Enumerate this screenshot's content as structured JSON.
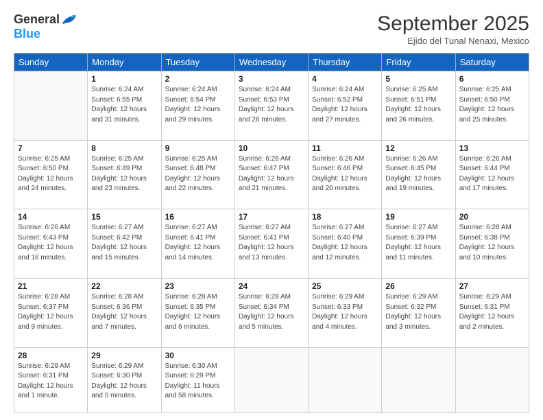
{
  "header": {
    "logo_general": "General",
    "logo_blue": "Blue",
    "month_title": "September 2025",
    "location": "Ejido del Tunal Nenaxi, Mexico"
  },
  "days_of_week": [
    "Sunday",
    "Monday",
    "Tuesday",
    "Wednesday",
    "Thursday",
    "Friday",
    "Saturday"
  ],
  "weeks": [
    [
      {
        "day": "",
        "info": ""
      },
      {
        "day": "1",
        "info": "Sunrise: 6:24 AM\nSunset: 6:55 PM\nDaylight: 12 hours\nand 31 minutes."
      },
      {
        "day": "2",
        "info": "Sunrise: 6:24 AM\nSunset: 6:54 PM\nDaylight: 12 hours\nand 29 minutes."
      },
      {
        "day": "3",
        "info": "Sunrise: 6:24 AM\nSunset: 6:53 PM\nDaylight: 12 hours\nand 28 minutes."
      },
      {
        "day": "4",
        "info": "Sunrise: 6:24 AM\nSunset: 6:52 PM\nDaylight: 12 hours\nand 27 minutes."
      },
      {
        "day": "5",
        "info": "Sunrise: 6:25 AM\nSunset: 6:51 PM\nDaylight: 12 hours\nand 26 minutes."
      },
      {
        "day": "6",
        "info": "Sunrise: 6:25 AM\nSunset: 6:50 PM\nDaylight: 12 hours\nand 25 minutes."
      }
    ],
    [
      {
        "day": "7",
        "info": "Sunrise: 6:25 AM\nSunset: 6:50 PM\nDaylight: 12 hours\nand 24 minutes."
      },
      {
        "day": "8",
        "info": "Sunrise: 6:25 AM\nSunset: 6:49 PM\nDaylight: 12 hours\nand 23 minutes."
      },
      {
        "day": "9",
        "info": "Sunrise: 6:25 AM\nSunset: 6:48 PM\nDaylight: 12 hours\nand 22 minutes."
      },
      {
        "day": "10",
        "info": "Sunrise: 6:26 AM\nSunset: 6:47 PM\nDaylight: 12 hours\nand 21 minutes."
      },
      {
        "day": "11",
        "info": "Sunrise: 6:26 AM\nSunset: 6:46 PM\nDaylight: 12 hours\nand 20 minutes."
      },
      {
        "day": "12",
        "info": "Sunrise: 6:26 AM\nSunset: 6:45 PM\nDaylight: 12 hours\nand 19 minutes."
      },
      {
        "day": "13",
        "info": "Sunrise: 6:26 AM\nSunset: 6:44 PM\nDaylight: 12 hours\nand 17 minutes."
      }
    ],
    [
      {
        "day": "14",
        "info": "Sunrise: 6:26 AM\nSunset: 6:43 PM\nDaylight: 12 hours\nand 16 minutes."
      },
      {
        "day": "15",
        "info": "Sunrise: 6:27 AM\nSunset: 6:42 PM\nDaylight: 12 hours\nand 15 minutes."
      },
      {
        "day": "16",
        "info": "Sunrise: 6:27 AM\nSunset: 6:41 PM\nDaylight: 12 hours\nand 14 minutes."
      },
      {
        "day": "17",
        "info": "Sunrise: 6:27 AM\nSunset: 6:41 PM\nDaylight: 12 hours\nand 13 minutes."
      },
      {
        "day": "18",
        "info": "Sunrise: 6:27 AM\nSunset: 6:40 PM\nDaylight: 12 hours\nand 12 minutes."
      },
      {
        "day": "19",
        "info": "Sunrise: 6:27 AM\nSunset: 6:39 PM\nDaylight: 12 hours\nand 11 minutes."
      },
      {
        "day": "20",
        "info": "Sunrise: 6:28 AM\nSunset: 6:38 PM\nDaylight: 12 hours\nand 10 minutes."
      }
    ],
    [
      {
        "day": "21",
        "info": "Sunrise: 6:28 AM\nSunset: 6:37 PM\nDaylight: 12 hours\nand 9 minutes."
      },
      {
        "day": "22",
        "info": "Sunrise: 6:28 AM\nSunset: 6:36 PM\nDaylight: 12 hours\nand 7 minutes."
      },
      {
        "day": "23",
        "info": "Sunrise: 6:28 AM\nSunset: 6:35 PM\nDaylight: 12 hours\nand 6 minutes."
      },
      {
        "day": "24",
        "info": "Sunrise: 6:28 AM\nSunset: 6:34 PM\nDaylight: 12 hours\nand 5 minutes."
      },
      {
        "day": "25",
        "info": "Sunrise: 6:29 AM\nSunset: 6:33 PM\nDaylight: 12 hours\nand 4 minutes."
      },
      {
        "day": "26",
        "info": "Sunrise: 6:29 AM\nSunset: 6:32 PM\nDaylight: 12 hours\nand 3 minutes."
      },
      {
        "day": "27",
        "info": "Sunrise: 6:29 AM\nSunset: 6:31 PM\nDaylight: 12 hours\nand 2 minutes."
      }
    ],
    [
      {
        "day": "28",
        "info": "Sunrise: 6:29 AM\nSunset: 6:31 PM\nDaylight: 12 hours\nand 1 minute."
      },
      {
        "day": "29",
        "info": "Sunrise: 6:29 AM\nSunset: 6:30 PM\nDaylight: 12 hours\nand 0 minutes."
      },
      {
        "day": "30",
        "info": "Sunrise: 6:30 AM\nSunset: 6:29 PM\nDaylight: 11 hours\nand 58 minutes."
      },
      {
        "day": "",
        "info": ""
      },
      {
        "day": "",
        "info": ""
      },
      {
        "day": "",
        "info": ""
      },
      {
        "day": "",
        "info": ""
      }
    ]
  ]
}
